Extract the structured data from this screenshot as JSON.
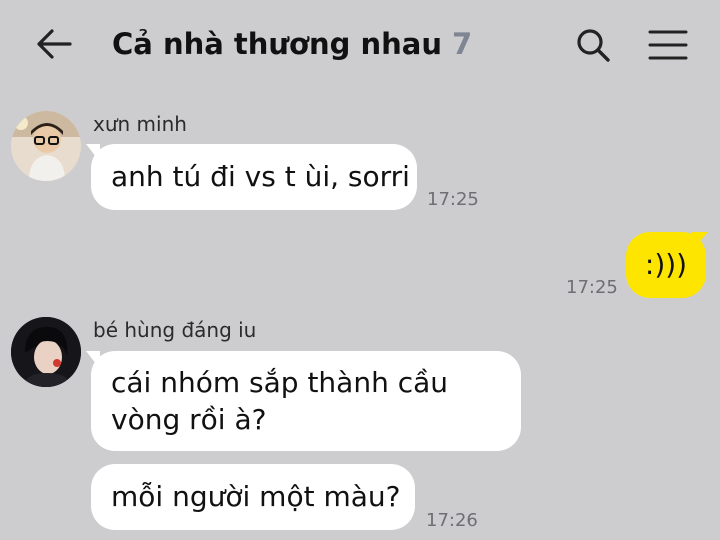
{
  "header": {
    "title": "Cả nhà thương nhau",
    "member_count": "7",
    "back_icon": "arrow-left-icon",
    "search_icon": "search-icon",
    "menu_icon": "menu-icon"
  },
  "colors": {
    "background": "#cdcdd0",
    "incoming_bubble": "#ffffff",
    "outgoing_bubble": "#fee500",
    "member_count": "#7d8692",
    "timestamp": "#6f6f73"
  },
  "messages": [
    {
      "sender": "xưn minh",
      "text": "anh tú đi vs t ùi, sorri",
      "time": "17:25",
      "direction": "incoming"
    },
    {
      "sender": "",
      "text": ":)))",
      "time": "17:25",
      "direction": "outgoing"
    },
    {
      "sender": "bé hùng đáng iu",
      "text": "cái nhóm sắp thành cầu vòng rồi à?",
      "time": "",
      "direction": "incoming"
    },
    {
      "sender": "bé hùng đáng iu",
      "text": "mỗi người một màu?",
      "time": "17:26",
      "direction": "incoming"
    }
  ]
}
